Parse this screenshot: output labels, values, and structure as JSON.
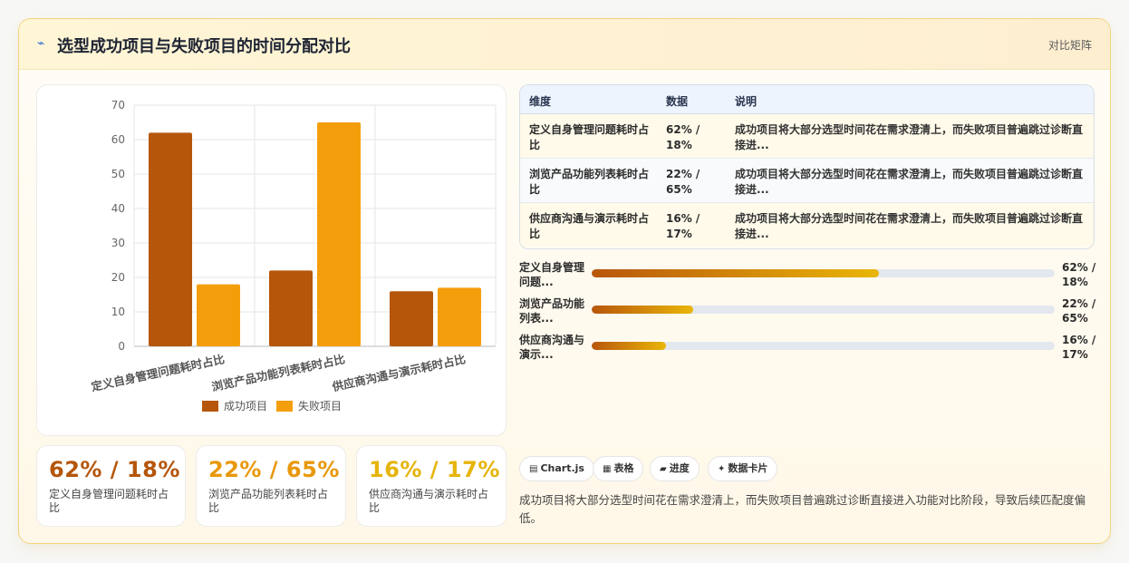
{
  "header": {
    "icon": "⌁",
    "title": "选型成功项目与失败项目的时间分配对比",
    "badge": "对比矩阵"
  },
  "chart_data": {
    "type": "bar",
    "categories": [
      "定义自身管理问题耗时占比",
      "浏览产品功能列表耗时占比",
      "供应商沟通与演示耗时占比"
    ],
    "series": [
      {
        "name": "成功项目",
        "values": [
          62,
          22,
          16
        ],
        "color": "#b5560b"
      },
      {
        "name": "失败项目",
        "values": [
          18,
          65,
          17
        ],
        "color": "#f59e0b"
      }
    ],
    "ylim": [
      0,
      70
    ],
    "yticks": [
      "0",
      "10",
      "20",
      "30",
      "40",
      "50",
      "60",
      "70"
    ],
    "legend": "bottom",
    "grid": true
  },
  "stats": [
    {
      "value": "62% / 18%",
      "label": "定义自身管理问题耗时占比",
      "color": "#b5560b"
    },
    {
      "value": "22% / 65%",
      "label": "浏览产品功能列表耗时占比",
      "color": "#e8980c"
    },
    {
      "value": "16% / 17%",
      "label": "供应商沟通与演示耗时占比",
      "color": "#e6b40c"
    }
  ],
  "table": {
    "headers": [
      "维度",
      "数据",
      "说明"
    ],
    "rows": [
      {
        "dim": "定义自身管理问题耗时占比",
        "data": "62% / 18%",
        "desc": "成功项目将大部分选型时间花在需求澄清上，而失败项目普遍跳过诊断直接进..."
      },
      {
        "dim": "浏览产品功能列表耗时占比",
        "data": "22% / 65%",
        "desc": "成功项目将大部分选型时间花在需求澄清上，而失败项目普遍跳过诊断直接进..."
      },
      {
        "dim": "供应商沟通与演示耗时占比",
        "data": "16% / 17%",
        "desc": "成功项目将大部分选型时间花在需求澄清上，而失败项目普遍跳过诊断直接进..."
      }
    ]
  },
  "progress": [
    {
      "label": "定义自身管理问题...",
      "value": "62% / 18%",
      "fraction": 0.62
    },
    {
      "label": "浏览产品功能列表...",
      "value": "22% / 65%",
      "fraction": 0.22
    },
    {
      "label": "供应商沟通与演示...",
      "value": "16% / 17%",
      "fraction": 0.16
    }
  ],
  "tags": [
    {
      "icon": "▤",
      "label": "Chart.js"
    },
    {
      "icon": "▦",
      "label": "表格"
    },
    {
      "icon": "▰",
      "label": "进度"
    },
    {
      "icon": "✦",
      "label": "数据卡片"
    }
  ],
  "summary": "成功项目将大部分选型时间花在需求澄清上，而失败项目普遍跳过诊断直接进入功能对比阶段，导致后续匹配度偏低。"
}
